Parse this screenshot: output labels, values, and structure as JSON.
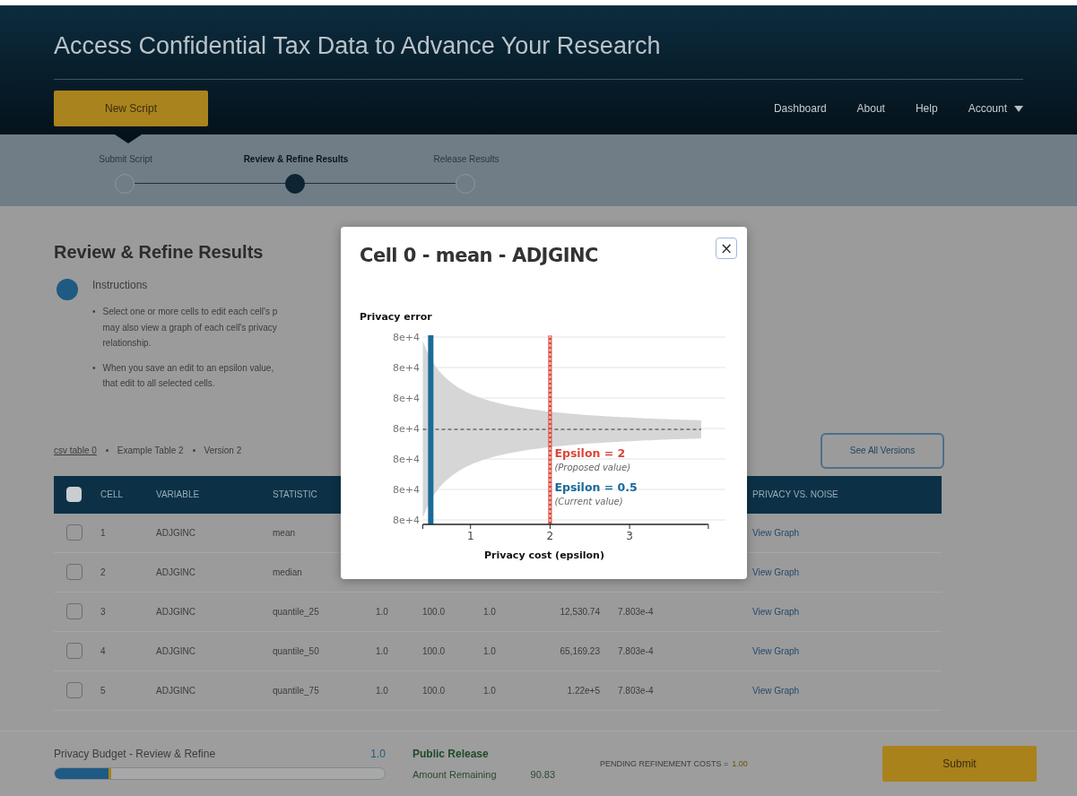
{
  "header": {
    "title": "Access Confidential Tax Data to Advance Your Research",
    "new_script_button": "New Script",
    "nav": [
      {
        "label": "Dashboard",
        "kind": "link"
      },
      {
        "label": "About",
        "kind": "link"
      },
      {
        "label": "Help",
        "kind": "link"
      },
      {
        "label": "Account",
        "kind": "menu"
      }
    ]
  },
  "steps": [
    {
      "label": "Submit Script",
      "selected": false
    },
    {
      "label": "Review & Refine Results",
      "selected": true
    },
    {
      "label": "Release Results",
      "selected": false
    }
  ],
  "section": {
    "heading": "Review & Refine Results",
    "instructions_title": "Instructions",
    "bullets": [
      {
        "marker": "•",
        "lines": [
          "Select one or more cells to edit each cell's p",
          "may also view a graph of each cell's privacy",
          "relationship."
        ]
      },
      {
        "marker": "•",
        "lines": [
          "When you save an edit to an epsilon value,",
          "that edit to all selected cells."
        ]
      }
    ]
  },
  "breadcrumb": [
    "csv table 0",
    "Example Table 2",
    "Version 2"
  ],
  "see_all_button": "See All Versions",
  "table": {
    "header_checked": false,
    "columns": [
      {
        "label": "CELL"
      },
      {
        "label": "VARIABLE"
      },
      {
        "label": "STATISTIC"
      },
      {
        "label": "PRIVACY VS. NOISE"
      }
    ],
    "rows": [
      {
        "checked": false,
        "cell": "1",
        "variable": "ADJGINC",
        "statistic": "mean",
        "link": "View Graph"
      },
      {
        "checked": false,
        "cell": "2",
        "variable": "ADJGINC",
        "statistic": "median",
        "link": "View Graph"
      },
      {
        "checked": false,
        "cell": "3",
        "variable": "ADJGINC",
        "statistic": "quantile_25",
        "column_4": "1.0",
        "column_5": "100.0",
        "column_6": "1.0",
        "column_7": "12,530.74",
        "column_8": "7.803e-4",
        "link": "View Graph"
      },
      {
        "checked": false,
        "cell": "4",
        "variable": "ADJGINC",
        "statistic": "quantile_50",
        "column_4": "1.0",
        "column_5": "100.0",
        "column_6": "1.0",
        "column_7": "65,169.23",
        "column_8": "7.803e-4",
        "link": "View Graph"
      },
      {
        "checked": false,
        "cell": "5",
        "variable": "ADJGINC",
        "statistic": "quantile_75",
        "column_4": "1.0",
        "column_5": "100.0",
        "column_6": "1.0",
        "column_7": "1.22e+5",
        "column_8": "7.803e-4",
        "link": "View Graph"
      }
    ]
  },
  "footer": {
    "budget_label": "Privacy Budget - Review & Refine",
    "budget_value": "1.0",
    "budget": {
      "level": 0.17
    },
    "release_title": "Public Release",
    "remaining_label": "Amount Remaining",
    "remaining_value": "90.83",
    "pending_label": "PENDING REFINEMENT COSTS =",
    "pending_value": "1.00",
    "submit_button": "Submit"
  },
  "modal": {
    "title": "Cell 0 - mean - ADJGINC",
    "close": "×",
    "y_tick_labels": [
      "8e+4",
      "8e+4",
      "8e+4",
      "8e+4",
      "8e+4",
      "8e+4",
      "8e+4"
    ],
    "x_tick_labels": [
      "1",
      "2",
      "3"
    ],
    "ylabel": "Privacy error",
    "xlabel": "Privacy cost (epsilon)",
    "markers": [
      {
        "kind": "proposed",
        "label": "Epsilon = 2",
        "note": "(Proposed value)",
        "color": "#d9473b"
      },
      {
        "kind": "current",
        "label": "Epsilon = 0.5",
        "note": "(Current value)",
        "color": "#1a6a9a"
      }
    ]
  }
}
